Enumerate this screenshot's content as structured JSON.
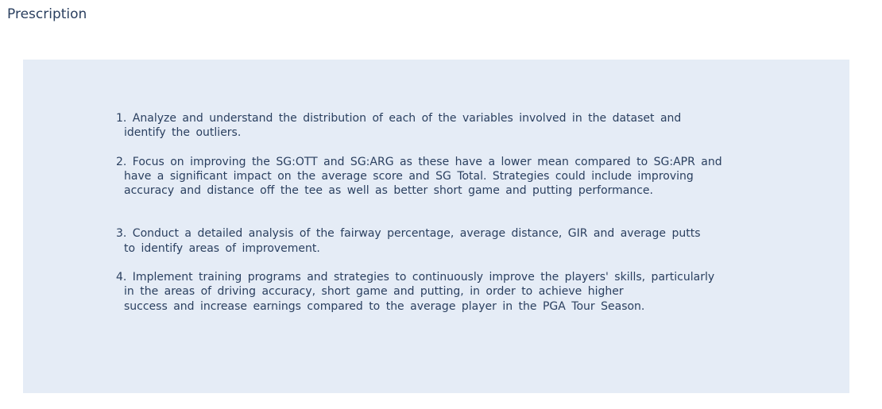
{
  "title": "Prescription",
  "items": [
    {
      "lines": [
        "1. Analyze and understand the distribution of each of the variables involved in the dataset and",
        "identify the outliers."
      ]
    },
    {
      "lines": [
        "2. Focus on improving the SG:OTT and SG:ARG as these have a lower mean compared to SG:APR and",
        "have a significant impact on the average score and SG Total. Strategies could include improving",
        "accuracy and distance off the tee as well as better short game and putting performance."
      ]
    },
    {
      "lines": [
        "3. Conduct a detailed analysis of the fairway percentage, average distance, GIR and average putts",
        "to identify areas of improvement."
      ]
    },
    {
      "lines": [
        "4. Implement training programs and strategies to continuously improve the players' skills, particularly",
        "in the areas of driving accuracy, short game and putting, in order to achieve higher",
        "success and increase earnings compared to the average player in the PGA Tour Season."
      ]
    }
  ]
}
